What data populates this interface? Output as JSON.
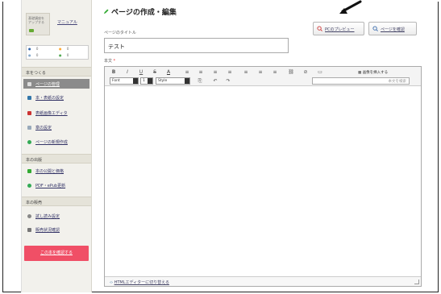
{
  "sidebar": {
    "logo_text": "基礎講座を\nアップする",
    "manual_label": "マニュアル",
    "counts": [
      "0",
      "0",
      "0",
      "0"
    ],
    "sections": [
      {
        "title": "本をつくる",
        "items": [
          {
            "label": "ページの管理",
            "active": true,
            "color": "#ddd"
          },
          {
            "label": "本・表紙の設定",
            "active": false,
            "color": "#37a"
          },
          {
            "label": "表紙画像エディタ",
            "active": false,
            "color": "#c33"
          },
          {
            "label": "章の設定",
            "active": false,
            "color": "#9ab"
          },
          {
            "label": "ページの新規作成",
            "active": false,
            "color": "#3a5"
          }
        ]
      },
      {
        "title": "本の出版",
        "items": [
          {
            "label": "本の公開と価格",
            "active": false,
            "color": "#3a3"
          },
          {
            "label": "PDF・ePub更新",
            "active": false,
            "color": "#3a5"
          }
        ]
      },
      {
        "title": "本の販売",
        "items": [
          {
            "label": "試し読み設定",
            "active": false,
            "color": "#888"
          },
          {
            "label": "販売状況確認",
            "active": false,
            "color": "#777"
          }
        ]
      }
    ],
    "cta_label": "この本を確認する"
  },
  "main": {
    "title": "ページの作成・編集",
    "preview_button": "PCのプレビュー",
    "confirm_button": "ページを確認",
    "page_title_label": "ページのタイトル",
    "page_title_value": "テスト",
    "body_label": "本文",
    "required_mark": "*",
    "toolbar": {
      "row1_buttons": [
        "B",
        "I",
        "U",
        "S",
        "A",
        "≡",
        "≡",
        "≡",
        "≡",
        "≡",
        "≡",
        "≡",
        "⛓",
        "⊘",
        "▭"
      ],
      "insert_table": "画像を挿入する",
      "font_select": "Font",
      "size_select": "1",
      "style_select": "Style",
      "search_placeholder": "本文を検索"
    },
    "footer_link": "HTMLエディターに切り替える"
  }
}
